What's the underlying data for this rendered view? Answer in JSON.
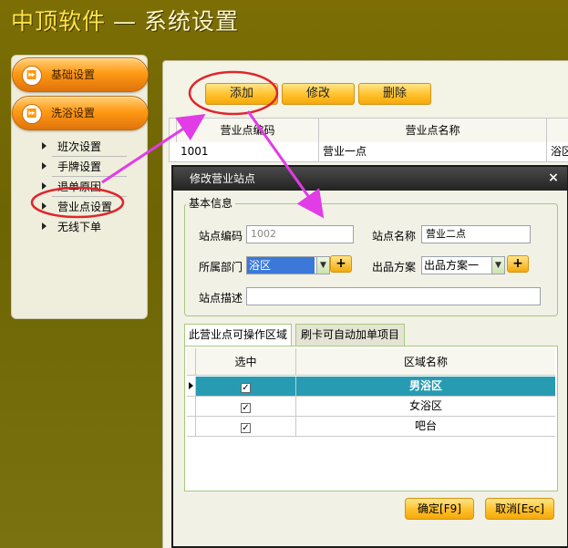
{
  "app": {
    "brand": "中顶软件",
    "dash": "—",
    "subtitle": "系统设置"
  },
  "sidebar": {
    "primary": [
      {
        "label": "基础设置"
      },
      {
        "label": "洗浴设置"
      }
    ],
    "items": [
      {
        "label": "班次设置"
      },
      {
        "label": "手牌设置"
      },
      {
        "label": "退单原因"
      },
      {
        "label": "营业点设置"
      },
      {
        "label": "无线下单"
      }
    ]
  },
  "toolbar": {
    "add_label": "添加",
    "edit_label": "修改",
    "delete_label": "删除"
  },
  "grid": {
    "columns": [
      "营业点编码",
      "营业点名称",
      ""
    ],
    "rows": [
      {
        "code": "1001",
        "name": "营业一点",
        "area": "浴区"
      }
    ]
  },
  "dialog": {
    "title": "修改营业站点",
    "close_glyph": "×",
    "group_label": "基本信息",
    "fields": {
      "code_label": "站点编码",
      "code_value": "1002",
      "name_label": "站点名称",
      "name_value": "营业二点",
      "dept_label": "所属部门",
      "dept_value": "浴区",
      "plan_label": "出品方案",
      "plan_value": "出品方案一",
      "desc_label": "站点描述",
      "desc_value": "",
      "plus": "+"
    },
    "tabs": [
      {
        "label": "此营业点可操作区域"
      },
      {
        "label": "刷卡可自动加单项目"
      }
    ],
    "table": {
      "columns": [
        "选中",
        "区域名称"
      ],
      "rows": [
        {
          "checked": true,
          "name": "男浴区",
          "selected": true
        },
        {
          "checked": true,
          "name": "女浴区",
          "selected": false
        },
        {
          "checked": true,
          "name": "吧台",
          "selected": false
        }
      ]
    },
    "ok_label": "确定[F9]",
    "cancel_label": "取消[Esc]"
  },
  "colors": {
    "background": "#746a06",
    "accent_orange": "#ff9a14",
    "button_yellow": "#ffc02a",
    "selected_row": "#279bb2",
    "annotation_red": "#e0252d",
    "annotation_magenta": "#e23ce6"
  },
  "icons": {
    "nav_button_icon": "fast-forward-icon",
    "subnav_bullet": "triangle-right-icon",
    "row_pointer": "row-pointer-icon",
    "close": "close-icon",
    "dropdown": "chevron-down-icon"
  }
}
